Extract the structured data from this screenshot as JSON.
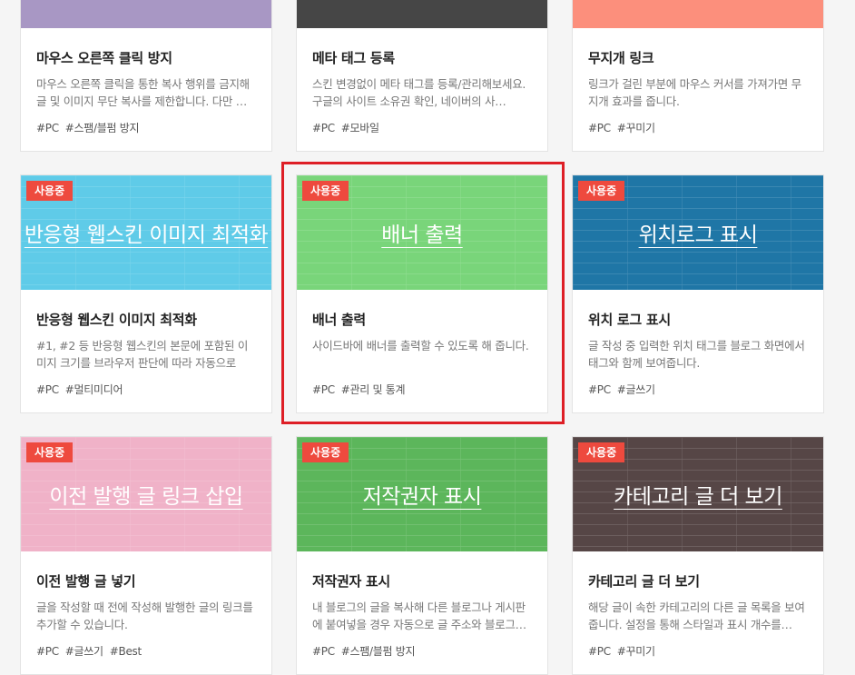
{
  "badge_label": "사용중",
  "cards": [
    {
      "name": "마우스 오른쪽 클릭 방지",
      "desc": "마우스 오른쪽 클릭을 통한 복사 행위를 금지해 글 및 이미지 무단 복사를 제한합니다. 다만 …",
      "tags": [
        "#PC",
        "#스팸/블펌 방지"
      ],
      "color": "#a897c4"
    },
    {
      "name": "메타 태그 등록",
      "desc": "스킨 변경없이 메타 태그를 등록/관리해보세요. 구글의 사이트 소유권 확인, 네이버의 사…",
      "tags": [
        "#PC",
        "#모바일"
      ],
      "color": "#464646"
    },
    {
      "name": "무지개 링크",
      "desc": "링크가 걸린 부분에 마우스 커서를 가져가면 무지개 효과를 줍니다.",
      "tags": [
        "#PC",
        "#꾸미기"
      ],
      "color": "#fc8f7c"
    },
    {
      "thumb_title": "반응형 웹스킨 이미지 최적화",
      "name": "반응형 웹스킨 이미지 최적화",
      "desc": "#1, #2 등 반응형 웹스킨의 본문에 포함된 이미지 크기를 브라우저 판단에 따라 자동으로 조…",
      "tags": [
        "#PC",
        "#멀티미디어"
      ],
      "color": "#5fcbe8"
    },
    {
      "thumb_title": "배너 출력",
      "name": "배너 출력",
      "desc": "사이드바에 배너를 출력할 수 있도록 해 줍니다.",
      "tags": [
        "#PC",
        "#관리 및 통계"
      ],
      "color": "#79d57a"
    },
    {
      "thumb_title": "위치로그 표시",
      "name": "위치 로그 표시",
      "desc": "글 작성 중 입력한 위치 태그를 블로그 화면에서 태그와 함께 보여줍니다.",
      "tags": [
        "#PC",
        "#글쓰기"
      ],
      "color": "#1f76a6"
    },
    {
      "thumb_title": "이전 발행 글 링크 삽입",
      "name": "이전 발행 글 넣기",
      "desc": "글을 작성할 때 전에 작성해 발행한 글의 링크를 추가할 수 있습니다.",
      "tags": [
        "#PC",
        "#글쓰기",
        "#Best"
      ],
      "color": "#f0b2c8"
    },
    {
      "thumb_title": "저작권자 표시",
      "name": "저작권자 표시",
      "desc": "내 블로그의 글을 복사해 다른 블로그나 게시판에 붙여넣을 경우 자동으로 글 주소와 블로그…",
      "tags": [
        "#PC",
        "#스팸/블펌 방지"
      ],
      "color": "#5cb65b"
    },
    {
      "thumb_title": "카테고리 글 더 보기",
      "name": "카테고리 글 더 보기",
      "desc": "해당 글이 속한 카테고리의 다른 글 목록을 보여줍니다. 설정을 통해 스타일과 표시 개수를…",
      "tags": [
        "#PC",
        "#꾸미기"
      ],
      "color": "#564646"
    }
  ]
}
